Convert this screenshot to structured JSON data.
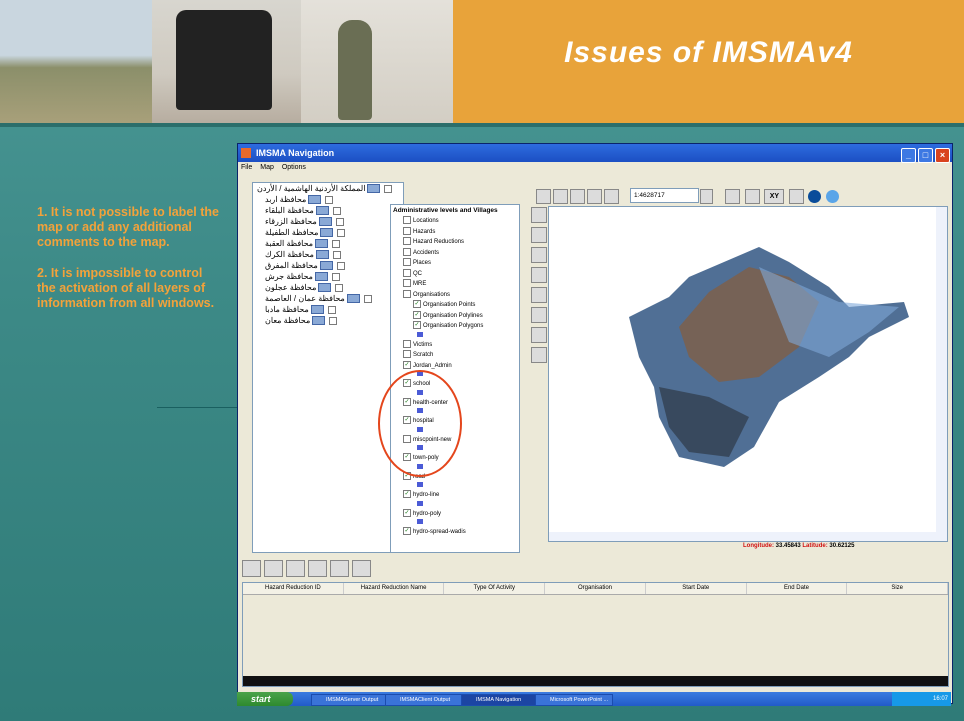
{
  "slide": {
    "title": "Issues of IMSMAv4",
    "bullets": [
      "1. It is not possible to label the map or add any additional comments to the map.",
      "2. It is impossible to control the activation of  all layers of information from all windows."
    ]
  },
  "window": {
    "title": "IMSMA Navigation",
    "menu": [
      "File",
      "Map",
      "Options"
    ],
    "scale_value": "1:4628717",
    "coords": {
      "lon_label": "Longitude:",
      "lon_value": "33.45843",
      "lat_label": "Latitude:",
      "lat_value": "30.62125"
    }
  },
  "tree": {
    "root": "المملكة الأردنية الهاشمية / الأردن",
    "items": [
      "محافظة اربد",
      "محافظة البلقاء",
      "محافظة الزرقاء",
      "محافظة الطفيلة",
      "محافظة العقبة",
      "محافظة الكرك",
      "محافظة المفرق",
      "محافظة جرش",
      "محافظة عجلون",
      "محافظة عمان / العاصمة",
      "محافظة مادبا",
      "محافظة معان"
    ]
  },
  "layers": {
    "header": "Administrative levels and Villages",
    "items": [
      {
        "label": "Locations",
        "checked": false
      },
      {
        "label": "Hazards",
        "checked": false
      },
      {
        "label": "Hazard Reductions",
        "checked": false
      },
      {
        "label": "Accidents",
        "checked": false
      },
      {
        "label": "Places",
        "checked": false
      },
      {
        "label": "QC",
        "checked": false
      },
      {
        "label": "MRE",
        "checked": false
      },
      {
        "label": "Organisations",
        "checked": false
      },
      {
        "label": "Organisation Points",
        "checked": true
      },
      {
        "label": "Organisation Polylines",
        "checked": true
      },
      {
        "label": "Organisation Polygons",
        "checked": true
      },
      {
        "label": "Victims",
        "checked": false
      },
      {
        "label": "Scratch",
        "checked": false
      },
      {
        "label": "Jordan_Admin",
        "checked": true
      },
      {
        "label": "school",
        "checked": true
      },
      {
        "label": "health-center",
        "checked": true
      },
      {
        "label": "hospital",
        "checked": true
      },
      {
        "label": "miscpoint-new",
        "checked": false
      },
      {
        "label": "town-poly",
        "checked": true
      },
      {
        "label": "road",
        "checked": true
      },
      {
        "label": "hydro-line",
        "checked": true
      },
      {
        "label": "hydro-poly",
        "checked": true
      },
      {
        "label": "hydro-spread-wadis",
        "checked": true
      }
    ]
  },
  "grid": {
    "columns": [
      "Hazard Reduction ID",
      "Hazard Reduction Name",
      "Type Of Activity",
      "Organisation",
      "Start Date",
      "End Date",
      "Size"
    ]
  },
  "taskbar": {
    "start": "start",
    "tasks": [
      "IMSMAServer Output",
      "IMSMAClient Output",
      "IMSMA Navigation",
      "Microsoft PowerPoint ..."
    ],
    "clock": "16:07"
  },
  "colors": {
    "accent": "#e8a33a",
    "bullet_text": "#f3a23a",
    "highlight_circle": "#e4461c",
    "coords_red": "#d01010"
  }
}
